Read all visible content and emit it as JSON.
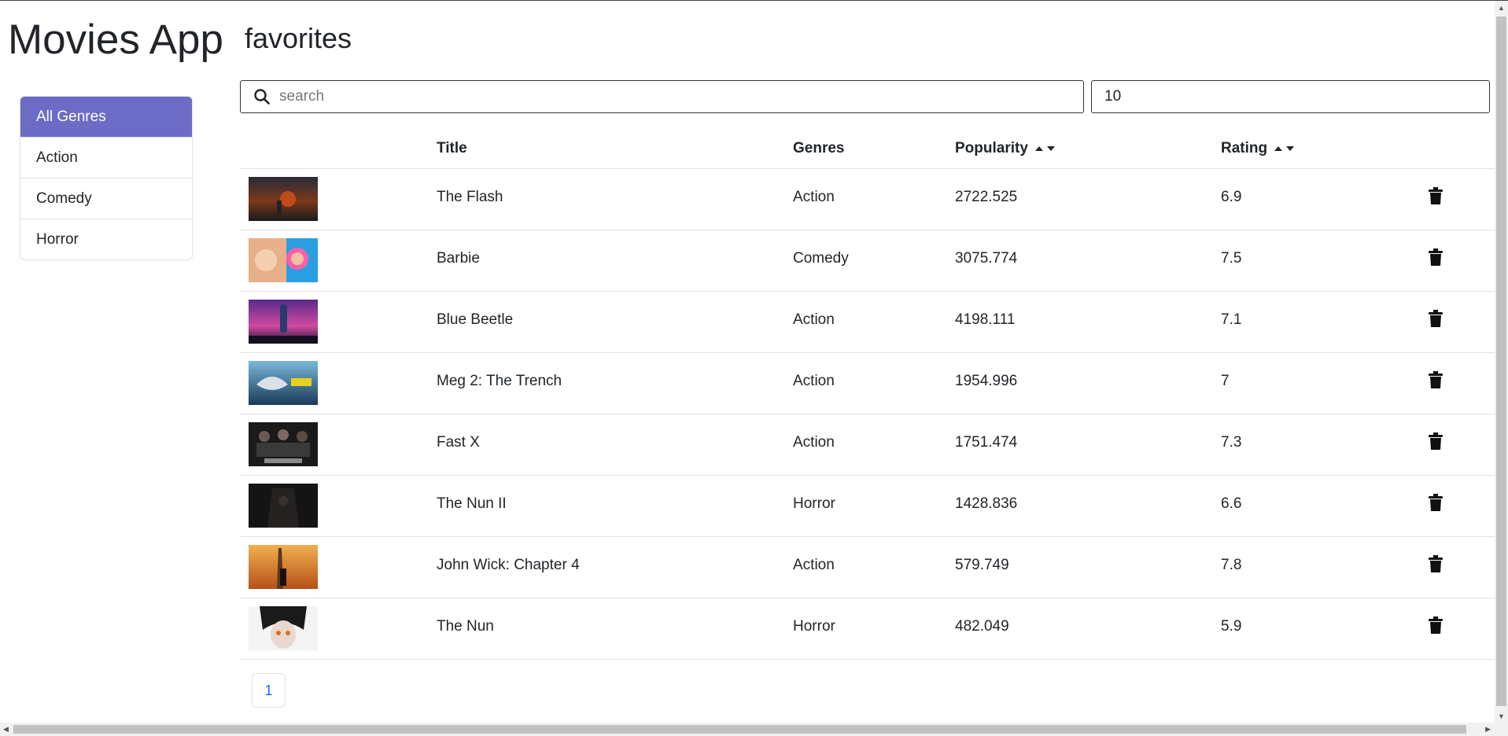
{
  "app_title": "Movies App",
  "page_title": "favorites",
  "sidebar": {
    "genres": [
      {
        "label": "All Genres",
        "active": true
      },
      {
        "label": "Action",
        "active": false
      },
      {
        "label": "Comedy",
        "active": false
      },
      {
        "label": "Horror",
        "active": false
      }
    ]
  },
  "search": {
    "placeholder": "search",
    "value": ""
  },
  "page_size": {
    "value": "10"
  },
  "table": {
    "headers": {
      "title": "Title",
      "genres": "Genres",
      "popularity": "Popularity",
      "rating": "Rating"
    },
    "rows": [
      {
        "title": "The Flash",
        "genre": "Action",
        "popularity": "2722.525",
        "rating": "6.9"
      },
      {
        "title": "Barbie",
        "genre": "Comedy",
        "popularity": "3075.774",
        "rating": "7.5"
      },
      {
        "title": "Blue Beetle",
        "genre": "Action",
        "popularity": "4198.111",
        "rating": "7.1"
      },
      {
        "title": "Meg 2: The Trench",
        "genre": "Action",
        "popularity": "1954.996",
        "rating": "7"
      },
      {
        "title": "Fast X",
        "genre": "Action",
        "popularity": "1751.474",
        "rating": "7.3"
      },
      {
        "title": "The Nun II",
        "genre": "Horror",
        "popularity": "1428.836",
        "rating": "6.6"
      },
      {
        "title": "John Wick: Chapter 4",
        "genre": "Action",
        "popularity": "579.749",
        "rating": "7.8"
      },
      {
        "title": "The Nun",
        "genre": "Horror",
        "popularity": "482.049",
        "rating": "5.9"
      }
    ]
  },
  "pagination": {
    "pages": [
      "1"
    ]
  },
  "colors": {
    "active_genre_bg": "#6c6bc6",
    "page_link": "#0d6efd"
  },
  "icons": {
    "search": "search-icon",
    "sort": "sort-up-down-icon",
    "delete": "trash-icon"
  }
}
